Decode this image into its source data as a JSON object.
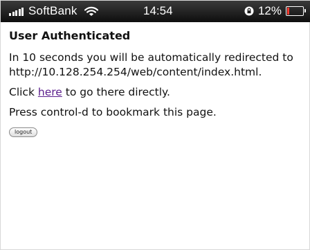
{
  "status_bar": {
    "carrier": "SoftBank",
    "time": "14:54",
    "battery_percent_label": "12%",
    "battery_level": 0.12,
    "signal_icon": "signal-bars-icon",
    "wifi_icon": "wifi-icon",
    "lock_icon": "orientation-lock-icon",
    "battery_icon": "battery-icon",
    "battery_color": "#ff3b30"
  },
  "page": {
    "title": "User Authenticated",
    "redirect_text": "In 10 seconds you will be automatically redirected to http://10.128.254.254/web/content/index.html.",
    "click_prefix": "Click ",
    "click_link": "here",
    "click_suffix": " to go there directly.",
    "bookmark_text": "Press control-d to bookmark this page.",
    "logout_label": "logout",
    "link_color": "#5a1e8c"
  }
}
